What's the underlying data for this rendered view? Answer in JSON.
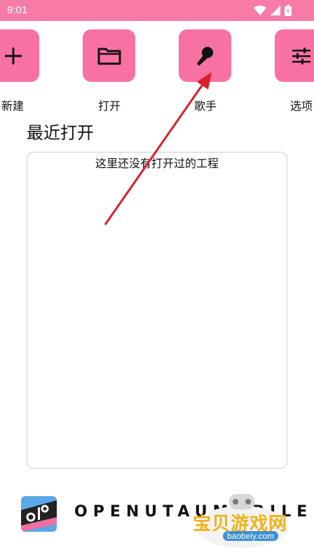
{
  "status_bar": {
    "time": "9:01",
    "icons": [
      "wifi-icon",
      "signal-icon",
      "battery-icon"
    ],
    "color": "#f67ba6"
  },
  "toolbar": {
    "accent": "#f871a3",
    "items": [
      {
        "label": "新建",
        "icon": "plus-icon"
      },
      {
        "label": "打开",
        "icon": "folder-icon"
      },
      {
        "label": "歌手",
        "icon": "microphone-icon"
      },
      {
        "label": "选项",
        "icon": "sliders-icon"
      }
    ]
  },
  "recent": {
    "title": "最近打开",
    "empty_message": "这里还没有打开过的工程"
  },
  "footer": {
    "brand": "OPENUTAUMOBILE"
  },
  "watermark": {
    "text": "宝贝游戏网",
    "url": "baobeiy.com"
  },
  "annotation": {
    "color": "#d91f2b"
  }
}
